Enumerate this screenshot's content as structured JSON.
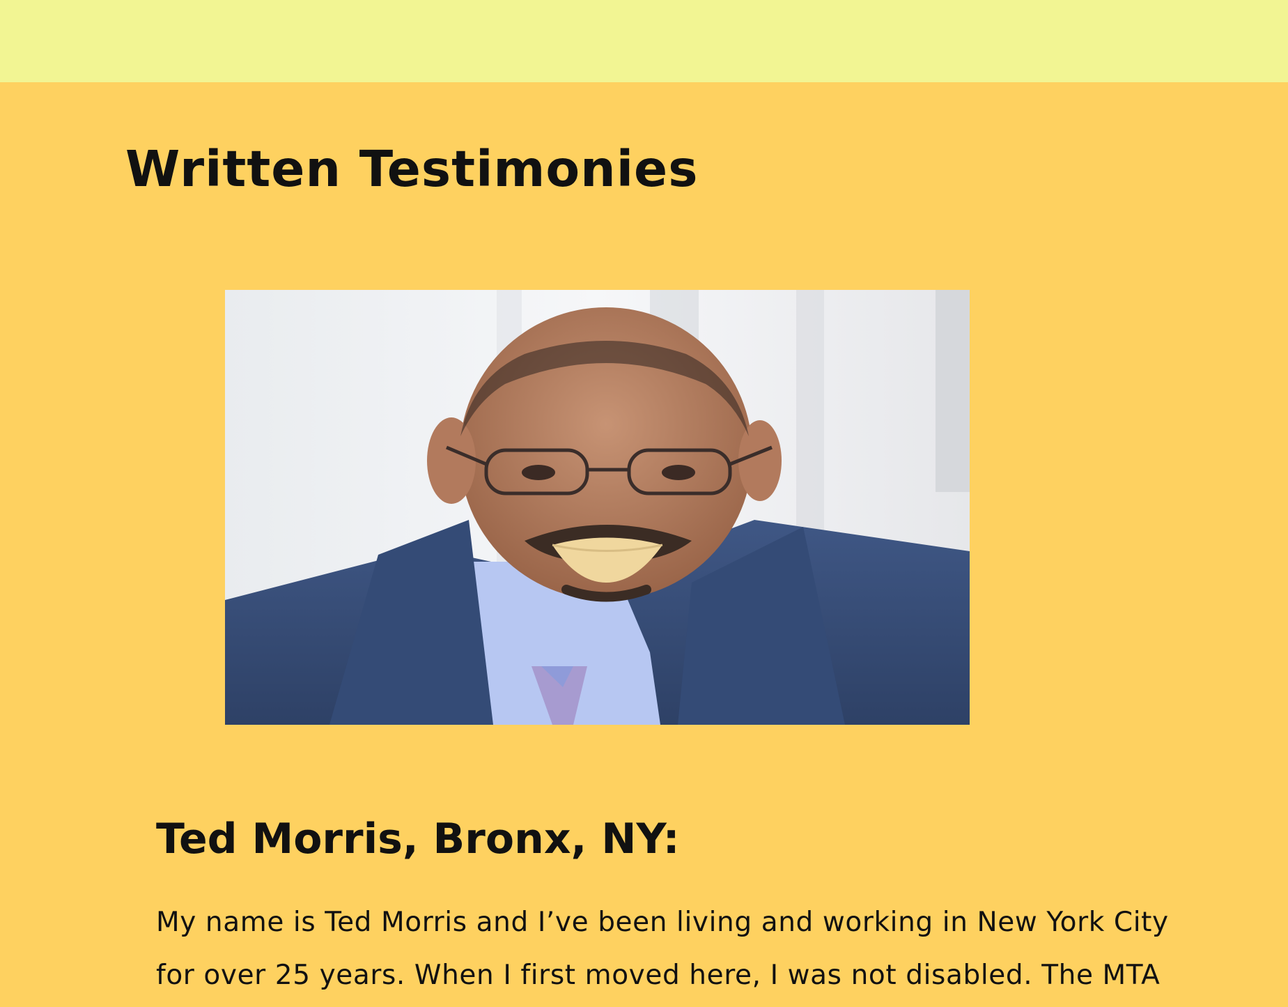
{
  "page": {
    "title": "Written Testimonies",
    "colors": {
      "header_band": "#f2f593",
      "background": "#fed160",
      "text": "#111111"
    }
  },
  "testimonial": {
    "photo_icon": "portrait-photo",
    "heading": "Ted Morris, Bronx, NY:",
    "body": "My name is Ted Morris and I’ve been living and working in New York City for over 25 years. When I first moved here, I was not disabled. The MTA"
  }
}
